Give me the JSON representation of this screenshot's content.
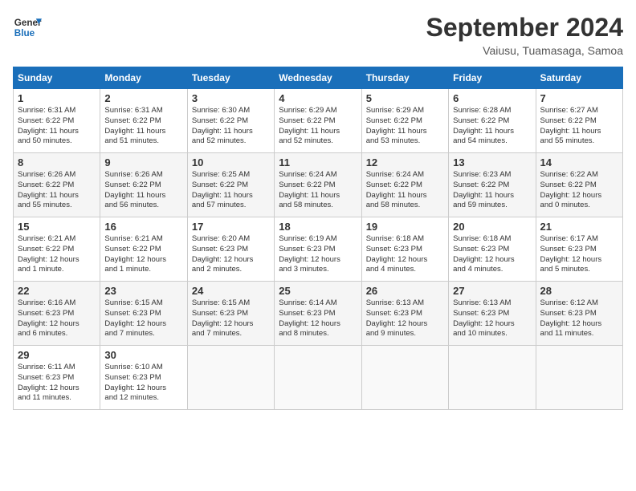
{
  "header": {
    "logo_line1": "General",
    "logo_line2": "Blue",
    "month": "September 2024",
    "location": "Vaiusu, Tuamasaga, Samoa"
  },
  "days_of_week": [
    "Sunday",
    "Monday",
    "Tuesday",
    "Wednesday",
    "Thursday",
    "Friday",
    "Saturday"
  ],
  "weeks": [
    [
      {
        "day": "1",
        "info": "Sunrise: 6:31 AM\nSunset: 6:22 PM\nDaylight: 11 hours\nand 50 minutes."
      },
      {
        "day": "2",
        "info": "Sunrise: 6:31 AM\nSunset: 6:22 PM\nDaylight: 11 hours\nand 51 minutes."
      },
      {
        "day": "3",
        "info": "Sunrise: 6:30 AM\nSunset: 6:22 PM\nDaylight: 11 hours\nand 52 minutes."
      },
      {
        "day": "4",
        "info": "Sunrise: 6:29 AM\nSunset: 6:22 PM\nDaylight: 11 hours\nand 52 minutes."
      },
      {
        "day": "5",
        "info": "Sunrise: 6:29 AM\nSunset: 6:22 PM\nDaylight: 11 hours\nand 53 minutes."
      },
      {
        "day": "6",
        "info": "Sunrise: 6:28 AM\nSunset: 6:22 PM\nDaylight: 11 hours\nand 54 minutes."
      },
      {
        "day": "7",
        "info": "Sunrise: 6:27 AM\nSunset: 6:22 PM\nDaylight: 11 hours\nand 55 minutes."
      }
    ],
    [
      {
        "day": "8",
        "info": "Sunrise: 6:26 AM\nSunset: 6:22 PM\nDaylight: 11 hours\nand 55 minutes."
      },
      {
        "day": "9",
        "info": "Sunrise: 6:26 AM\nSunset: 6:22 PM\nDaylight: 11 hours\nand 56 minutes."
      },
      {
        "day": "10",
        "info": "Sunrise: 6:25 AM\nSunset: 6:22 PM\nDaylight: 11 hours\nand 57 minutes."
      },
      {
        "day": "11",
        "info": "Sunrise: 6:24 AM\nSunset: 6:22 PM\nDaylight: 11 hours\nand 58 minutes."
      },
      {
        "day": "12",
        "info": "Sunrise: 6:24 AM\nSunset: 6:22 PM\nDaylight: 11 hours\nand 58 minutes."
      },
      {
        "day": "13",
        "info": "Sunrise: 6:23 AM\nSunset: 6:22 PM\nDaylight: 11 hours\nand 59 minutes."
      },
      {
        "day": "14",
        "info": "Sunrise: 6:22 AM\nSunset: 6:22 PM\nDaylight: 12 hours\nand 0 minutes."
      }
    ],
    [
      {
        "day": "15",
        "info": "Sunrise: 6:21 AM\nSunset: 6:22 PM\nDaylight: 12 hours\nand 1 minute."
      },
      {
        "day": "16",
        "info": "Sunrise: 6:21 AM\nSunset: 6:22 PM\nDaylight: 12 hours\nand 1 minute."
      },
      {
        "day": "17",
        "info": "Sunrise: 6:20 AM\nSunset: 6:23 PM\nDaylight: 12 hours\nand 2 minutes."
      },
      {
        "day": "18",
        "info": "Sunrise: 6:19 AM\nSunset: 6:23 PM\nDaylight: 12 hours\nand 3 minutes."
      },
      {
        "day": "19",
        "info": "Sunrise: 6:18 AM\nSunset: 6:23 PM\nDaylight: 12 hours\nand 4 minutes."
      },
      {
        "day": "20",
        "info": "Sunrise: 6:18 AM\nSunset: 6:23 PM\nDaylight: 12 hours\nand 4 minutes."
      },
      {
        "day": "21",
        "info": "Sunrise: 6:17 AM\nSunset: 6:23 PM\nDaylight: 12 hours\nand 5 minutes."
      }
    ],
    [
      {
        "day": "22",
        "info": "Sunrise: 6:16 AM\nSunset: 6:23 PM\nDaylight: 12 hours\nand 6 minutes."
      },
      {
        "day": "23",
        "info": "Sunrise: 6:15 AM\nSunset: 6:23 PM\nDaylight: 12 hours\nand 7 minutes."
      },
      {
        "day": "24",
        "info": "Sunrise: 6:15 AM\nSunset: 6:23 PM\nDaylight: 12 hours\nand 7 minutes."
      },
      {
        "day": "25",
        "info": "Sunrise: 6:14 AM\nSunset: 6:23 PM\nDaylight: 12 hours\nand 8 minutes."
      },
      {
        "day": "26",
        "info": "Sunrise: 6:13 AM\nSunset: 6:23 PM\nDaylight: 12 hours\nand 9 minutes."
      },
      {
        "day": "27",
        "info": "Sunrise: 6:13 AM\nSunset: 6:23 PM\nDaylight: 12 hours\nand 10 minutes."
      },
      {
        "day": "28",
        "info": "Sunrise: 6:12 AM\nSunset: 6:23 PM\nDaylight: 12 hours\nand 11 minutes."
      }
    ],
    [
      {
        "day": "29",
        "info": "Sunrise: 6:11 AM\nSunset: 6:23 PM\nDaylight: 12 hours\nand 11 minutes."
      },
      {
        "day": "30",
        "info": "Sunrise: 6:10 AM\nSunset: 6:23 PM\nDaylight: 12 hours\nand 12 minutes."
      },
      {
        "day": "",
        "info": ""
      },
      {
        "day": "",
        "info": ""
      },
      {
        "day": "",
        "info": ""
      },
      {
        "day": "",
        "info": ""
      },
      {
        "day": "",
        "info": ""
      }
    ]
  ]
}
